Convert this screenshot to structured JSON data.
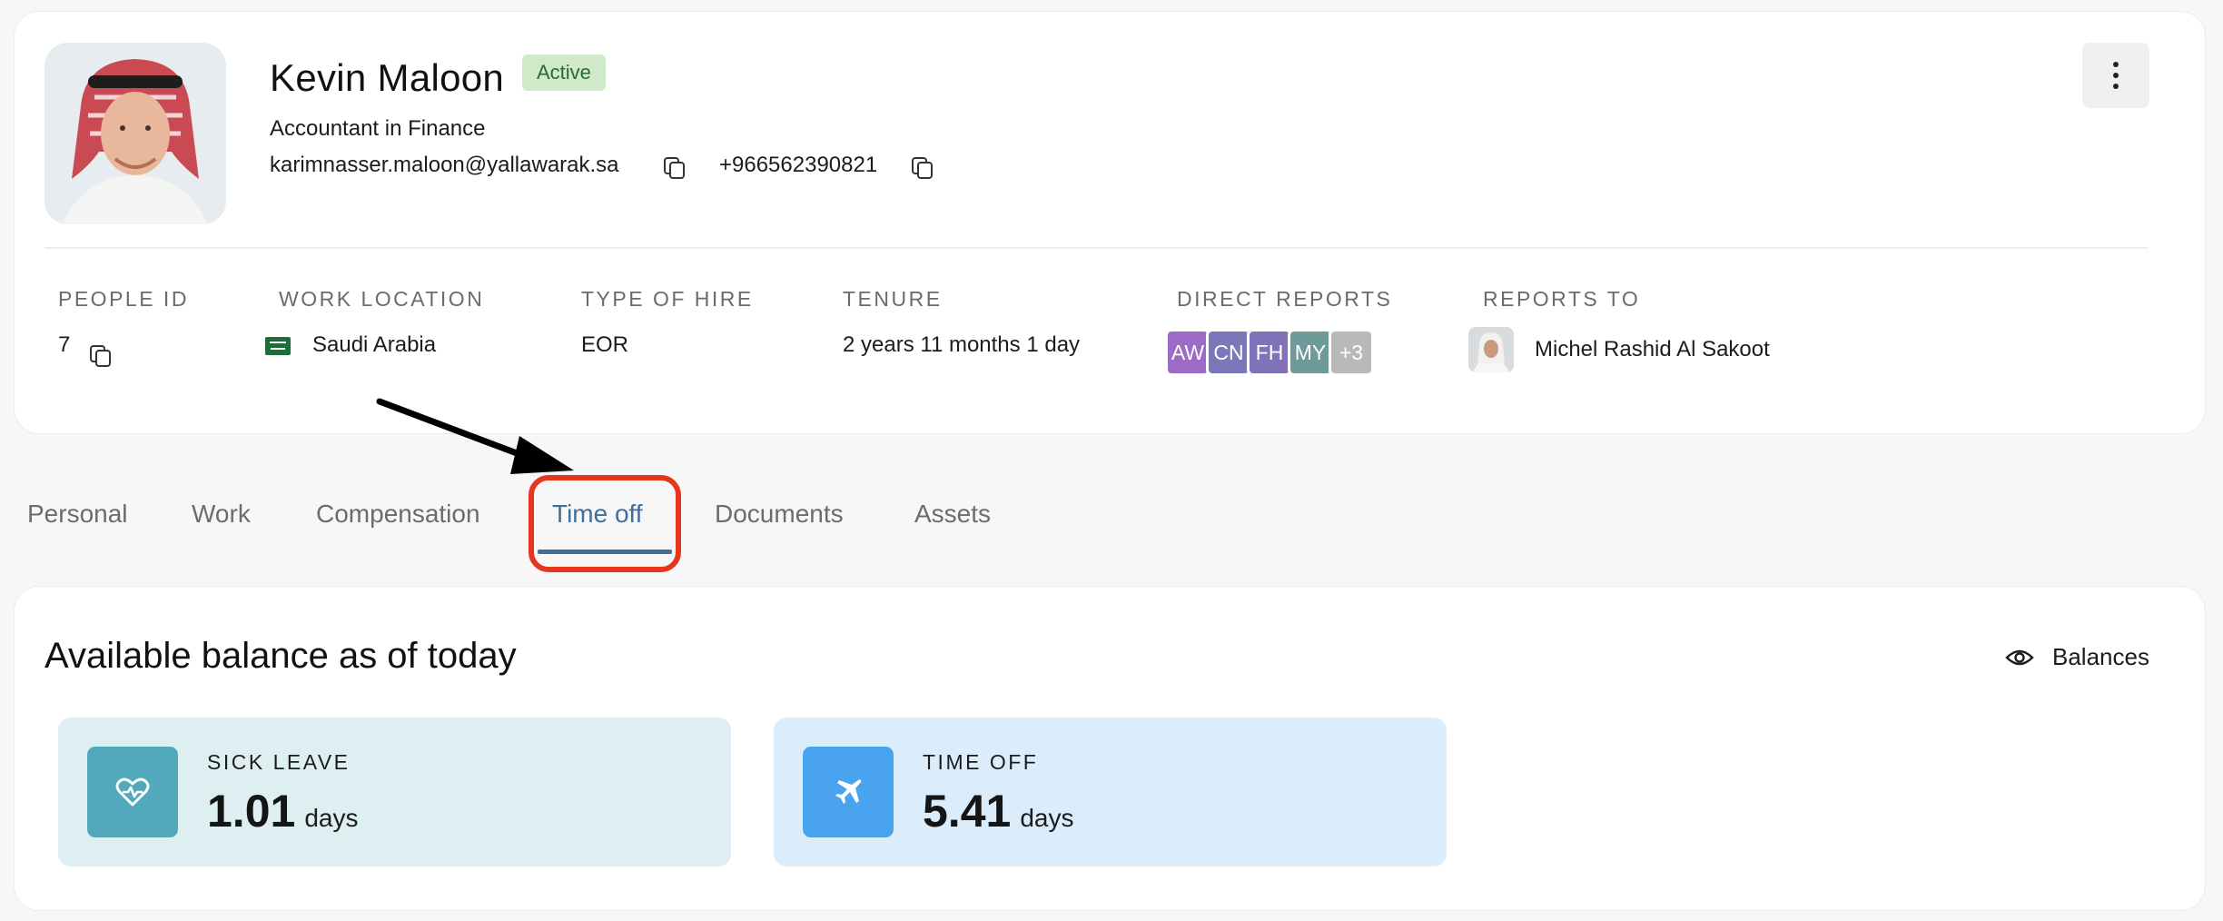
{
  "profile": {
    "name": "Kevin Maloon",
    "status": "Active",
    "job_title": "Accountant in Finance",
    "email": "karimnasser.maloon@yallawarak.sa",
    "phone": "+966562390821"
  },
  "meta": {
    "people_id_label": "PEOPLE ID",
    "people_id_value": "7",
    "work_location_label": "WORK LOCATION",
    "work_location_value": "Saudi Arabia",
    "type_of_hire_label": "TYPE OF HIRE",
    "type_of_hire_value": "EOR",
    "tenure_label": "TENURE",
    "tenure_value": "2 years 11 months 1 day",
    "direct_reports_label": "DIRECT REPORTS",
    "direct_reports": [
      {
        "initials": "AW",
        "color": "#9b6bc6"
      },
      {
        "initials": "CN",
        "color": "#7a78b8"
      },
      {
        "initials": "FH",
        "color": "#8072b8"
      },
      {
        "initials": "MY",
        "color": "#6f9a9a"
      },
      {
        "initials": "+3",
        "color": "#b9b9b9"
      }
    ],
    "reports_to_label": "REPORTS TO",
    "reports_to_value": "Michel Rashid Al Sakoot"
  },
  "tabs": [
    "Personal",
    "Work",
    "Compensation",
    "Time off",
    "Documents",
    "Assets"
  ],
  "active_tab": "Time off",
  "balance": {
    "title": "Available balance as of today",
    "balances_link": "Balances",
    "tiles": [
      {
        "label": "SICK LEAVE",
        "value": "1.01",
        "unit": "days",
        "icon": "heart-pulse-icon",
        "bg": "#deeff2",
        "icon_bg": "#52a9bb"
      },
      {
        "label": "TIME OFF",
        "value": "5.41",
        "unit": "days",
        "icon": "airplane-icon",
        "bg": "#dbedfb",
        "icon_bg": "#4aa3ee"
      }
    ]
  },
  "colors": {
    "accent": "#3f6f9c",
    "highlight": "#e5371f",
    "status_bg": "#cfe9c9",
    "status_text": "#2b6a2c"
  }
}
